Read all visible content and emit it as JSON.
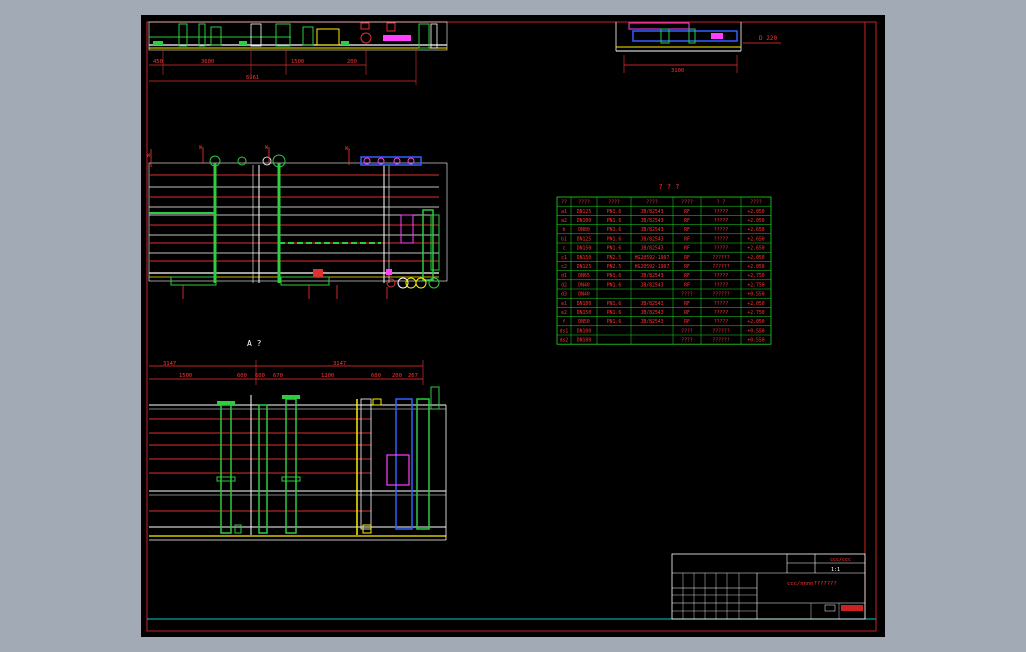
{
  "drawing": {
    "colors": {
      "background": "#000000",
      "frame": "#cc2222",
      "table_line": "#22dd22",
      "pipe_green": "#2ecc40",
      "pipe_red": "#e03030",
      "pipe_white": "#f0f0f0",
      "pipe_yellow": "#ffee00",
      "pipe_magenta": "#ff40ff",
      "pipe_blue": "#3060ff",
      "cyan": "#00e5ee",
      "text_red": "#ff3333"
    },
    "top_left_dims": [
      "450",
      "3600",
      "1500",
      "200"
    ],
    "top_left_total": "6961",
    "top_right_dim": "3100",
    "top_right_label": "D 220",
    "mid_labels": [
      "W",
      "W",
      "W",
      "W"
    ],
    "view_label": "A ?",
    "bottom_upper_dims": [
      "3147",
      "3147"
    ],
    "bottom_lower_dims": [
      "1500",
      "600",
      "600",
      "670",
      "1200",
      "600",
      "200",
      "267"
    ],
    "nozzle_table": {
      "title": "? ? ?",
      "headers": [
        "??",
        "????",
        "????",
        "????",
        "????",
        "?    ?",
        "????"
      ],
      "rows": [
        [
          "a1",
          "DN125",
          "PN1.6",
          "JB/82543",
          "RF",
          "?????",
          "+2.050"
        ],
        [
          "a2",
          "DN100",
          "PN1.6",
          "JB/82543",
          "RF",
          "?????",
          "+2.050"
        ],
        [
          "b",
          "DN80",
          "PN1.6",
          "JB/82543",
          "RF",
          "?????",
          "+2.650"
        ],
        [
          "b1",
          "DN125",
          "PN1.6",
          "JB/82543",
          "RF",
          "?????",
          "+2.650"
        ],
        [
          "c",
          "DN150",
          "PN1.6",
          "JB/82543",
          "RF",
          "?????",
          "+2.650"
        ],
        [
          "c1",
          "DN150",
          "PN2.5",
          "HG20592-1997",
          "RF",
          "??????",
          "+2.050"
        ],
        [
          "c2",
          "DN125",
          "PN2.5",
          "HG20592-1997",
          "RF",
          "??????",
          "+2.050"
        ],
        [
          "d1",
          "DN65",
          "PN1.6",
          "JB/82543",
          "RF",
          "?????",
          "+2.750"
        ],
        [
          "d2",
          "DN40",
          "PN1.6",
          "JB/82543",
          "RF",
          "?????",
          "+2.750"
        ],
        [
          "d3",
          "DN40",
          "",
          "",
          "????",
          "??????",
          "+0.550"
        ],
        [
          "e1",
          "DN100",
          "PN1.6",
          "JB/82543",
          "RF",
          "?????",
          "+2.050"
        ],
        [
          "e2",
          "DN150",
          "PN1.6",
          "JB/82543",
          "RF",
          "?????",
          "+2.750"
        ],
        [
          "f",
          "DN50",
          "PN1.6",
          "JB/82543",
          "RF",
          "?????",
          "+2.050"
        ],
        [
          "ds1",
          "DN100",
          "",
          "",
          "????",
          "??????",
          "+0.550"
        ],
        [
          "ds2",
          "DN100",
          "",
          "",
          "????",
          "??????",
          "+0.550"
        ]
      ]
    },
    "title_block": {
      "company": "ccc/ccc",
      "drawing_name": "ccc/nnnn???????",
      "scale_label": "1:1"
    }
  }
}
